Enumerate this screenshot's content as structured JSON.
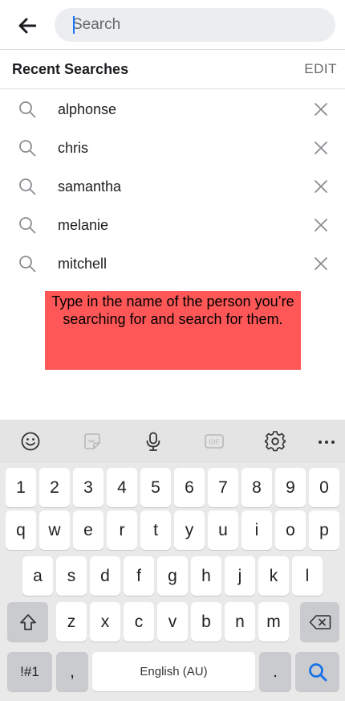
{
  "search": {
    "placeholder": "Search",
    "back_icon": "arrow-left-icon"
  },
  "recent": {
    "title": "Recent Searches",
    "edit_label": "EDIT",
    "items": [
      {
        "label": "alphonse"
      },
      {
        "label": "chris"
      },
      {
        "label": "samantha"
      },
      {
        "label": "melanie"
      },
      {
        "label": "mitchell"
      }
    ]
  },
  "annotation": {
    "text": "Type in the name of the person you’re searching for and search for them.",
    "color": "#ff5757"
  },
  "keyboard": {
    "toolbar_icons": [
      "emoji-icon",
      "sticker-icon",
      "microphone-icon",
      "gif-icon",
      "settings-icon",
      "more-icon"
    ],
    "gif_label": "GIF",
    "number_row": [
      "1",
      "2",
      "3",
      "4",
      "5",
      "6",
      "7",
      "8",
      "9",
      "0"
    ],
    "row1": [
      "q",
      "w",
      "e",
      "r",
      "t",
      "y",
      "u",
      "i",
      "o",
      "p"
    ],
    "row2": [
      "a",
      "s",
      "d",
      "f",
      "g",
      "h",
      "j",
      "k",
      "l"
    ],
    "row3": [
      "z",
      "x",
      "c",
      "v",
      "b",
      "n",
      "m"
    ],
    "mode_key": "!#1",
    "comma": ",",
    "space_label": "English (AU)",
    "period": "."
  },
  "colors": {
    "accent": "#1877f2",
    "search_key_icon": "#1a73e8"
  }
}
